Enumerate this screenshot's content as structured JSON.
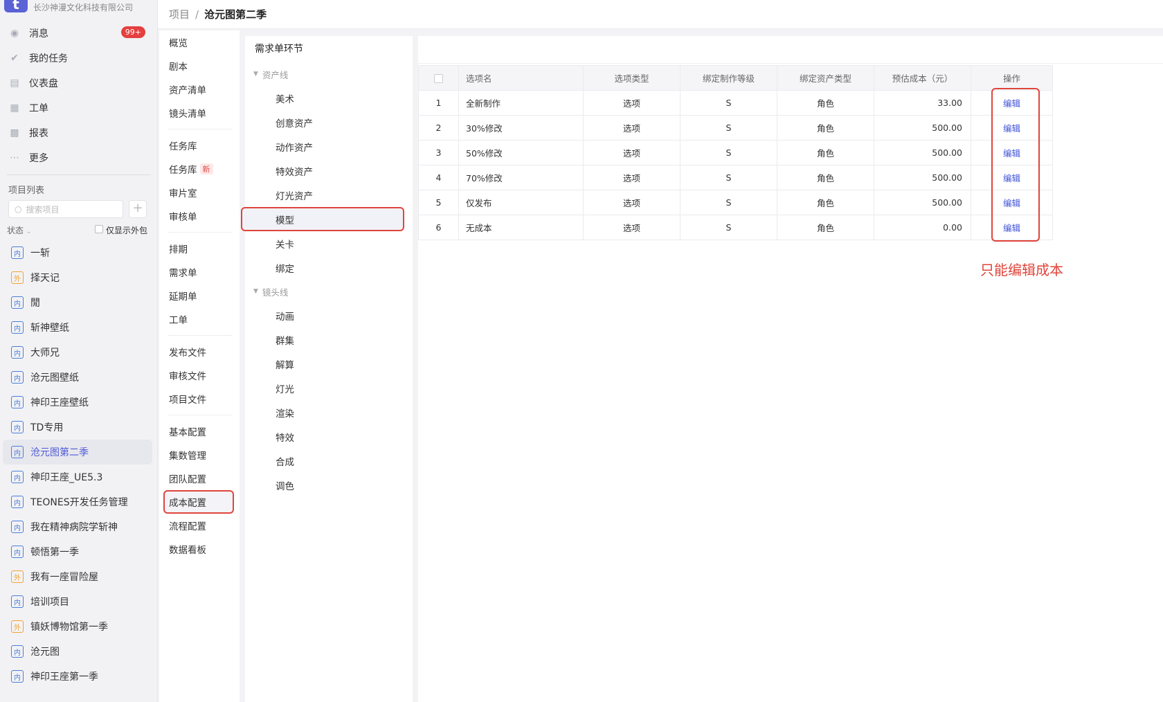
{
  "company": {
    "logo_letter": "t",
    "name": "长沙神漫文化科技有限公司"
  },
  "nav": [
    {
      "label": "消息",
      "icon": "message-icon",
      "badge": "99+"
    },
    {
      "label": "我的任务",
      "icon": "check-icon"
    },
    {
      "label": "仪表盘",
      "icon": "dashboard-icon"
    },
    {
      "label": "工单",
      "icon": "ticket-icon"
    },
    {
      "label": "报表",
      "icon": "report-icon"
    },
    {
      "label": "更多",
      "icon": "more-icon"
    }
  ],
  "projects": {
    "title": "项目列表",
    "search_placeholder": "搜索项目",
    "add_label": "+",
    "filter_state": "状态",
    "filter_checkbox_label": "仅显示外包",
    "items": [
      {
        "tag": "内",
        "name": "一斩"
      },
      {
        "tag": "外",
        "name": "择天记"
      },
      {
        "tag": "内",
        "name": "閒"
      },
      {
        "tag": "内",
        "name": "斩神壁纸"
      },
      {
        "tag": "内",
        "name": "大师兄"
      },
      {
        "tag": "内",
        "name": "沧元图壁纸"
      },
      {
        "tag": "内",
        "name": "神印王座壁纸"
      },
      {
        "tag": "内",
        "name": "TD专用"
      },
      {
        "tag": "内",
        "name": "沧元图第二季",
        "active": true
      },
      {
        "tag": "内",
        "name": "神印王座_UE5.3"
      },
      {
        "tag": "内",
        "name": "TEONES开发任务管理"
      },
      {
        "tag": "内",
        "name": "我在精神病院学斩神"
      },
      {
        "tag": "内",
        "name": "顿悟第一季"
      },
      {
        "tag": "外",
        "name": "我有一座冒险屋"
      },
      {
        "tag": "内",
        "name": "培训项目"
      },
      {
        "tag": "外",
        "name": "镇妖博物馆第一季"
      },
      {
        "tag": "内",
        "name": "沧元图"
      },
      {
        "tag": "内",
        "name": "神印王座第一季"
      }
    ]
  },
  "header": {
    "crumb_root": "项目",
    "crumb_sep": "/",
    "crumb_current": "沧元图第二季"
  },
  "submenu": {
    "groups": [
      [
        "概览",
        "剧本",
        "资产清单",
        "镜头清单"
      ],
      [
        "任务库",
        "任务库",
        "审片室",
        "审核单"
      ],
      [
        "排期",
        "需求单",
        "延期单",
        "工单"
      ],
      [
        "发布文件",
        "审核文件",
        "项目文件"
      ],
      [
        "基本配置",
        "集数管理",
        "团队配置",
        "成本配置",
        "流程配置",
        "数据看板"
      ]
    ],
    "new_tag": "新",
    "selected": "成本配置"
  },
  "tree": {
    "title": "需求单环节",
    "group1": {
      "label": "资产线",
      "items": [
        "美术",
        "创意资产",
        "动作资产",
        "特效资产",
        "灯光资产",
        "模型",
        "关卡",
        "绑定"
      ]
    },
    "group2": {
      "label": "镜头线",
      "items": [
        "动画",
        "群集",
        "解算",
        "灯光",
        "渲染",
        "特效",
        "合成",
        "调色"
      ]
    },
    "selected": "模型"
  },
  "table": {
    "headers": [
      "选项名",
      "选项类型",
      "绑定制作等级",
      "绑定资产类型",
      "预估成本（元）",
      "操作"
    ],
    "rows": [
      {
        "idx": "1",
        "name": "全新制作",
        "type": "选项",
        "level": "S",
        "asset": "角色",
        "cost": "33.00",
        "op": "编辑"
      },
      {
        "idx": "2",
        "name": "30%修改",
        "type": "选项",
        "level": "S",
        "asset": "角色",
        "cost": "500.00",
        "op": "编辑"
      },
      {
        "idx": "3",
        "name": "50%修改",
        "type": "选项",
        "level": "S",
        "asset": "角色",
        "cost": "500.00",
        "op": "编辑"
      },
      {
        "idx": "4",
        "name": "70%修改",
        "type": "选项",
        "level": "S",
        "asset": "角色",
        "cost": "500.00",
        "op": "编辑"
      },
      {
        "idx": "5",
        "name": "仅发布",
        "type": "选项",
        "level": "S",
        "asset": "角色",
        "cost": "500.00",
        "op": "编辑"
      },
      {
        "idx": "6",
        "name": "无成本",
        "type": "选项",
        "level": "S",
        "asset": "角色",
        "cost": "0.00",
        "op": "编辑"
      }
    ]
  },
  "annotation": {
    "note": "只能编辑成本",
    "color": "#e0443a"
  },
  "colors": {
    "accent": "#4f5bd5",
    "link": "#3f52d8",
    "badge": "#e53f3f"
  }
}
